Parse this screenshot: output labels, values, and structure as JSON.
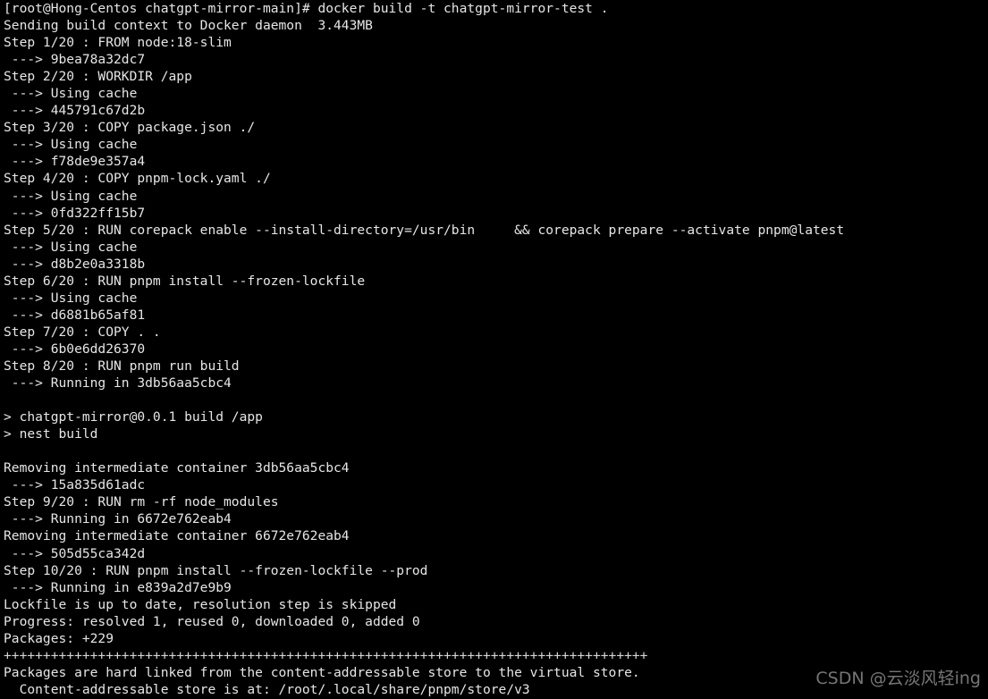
{
  "terminal": {
    "colors": {
      "background": "#000000",
      "foreground": "#e6e6e6",
      "watermark": "#8a8a8a"
    },
    "prompt": {
      "user": "root",
      "host": "Hong-Centos",
      "directory": "chatgpt-mirror-main",
      "symbol": "#",
      "full": "[root@Hong-Centos chatgpt-mirror-main]#"
    },
    "command": "docker build -t chatgpt-mirror-test .",
    "lines": [
      "[root@Hong-Centos chatgpt-mirror-main]# docker build -t chatgpt-mirror-test .",
      "Sending build context to Docker daemon  3.443MB",
      "Step 1/20 : FROM node:18-slim",
      " ---> 9bea78a32dc7",
      "Step 2/20 : WORKDIR /app",
      " ---> Using cache",
      " ---> 445791c67d2b",
      "Step 3/20 : COPY package.json ./",
      " ---> Using cache",
      " ---> f78de9e357a4",
      "Step 4/20 : COPY pnpm-lock.yaml ./",
      " ---> Using cache",
      " ---> 0fd322ff15b7",
      "Step 5/20 : RUN corepack enable --install-directory=/usr/bin     && corepack prepare --activate pnpm@latest",
      " ---> Using cache",
      " ---> d8b2e0a3318b",
      "Step 6/20 : RUN pnpm install --frozen-lockfile",
      " ---> Using cache",
      " ---> d6881b65af81",
      "Step 7/20 : COPY . .",
      " ---> 6b0e6dd26370",
      "Step 8/20 : RUN pnpm run build",
      " ---> Running in 3db56aa5cbc4",
      "",
      "> chatgpt-mirror@0.0.1 build /app",
      "> nest build",
      "",
      "Removing intermediate container 3db56aa5cbc4",
      " ---> 15a835d61adc",
      "Step 9/20 : RUN rm -rf node_modules",
      " ---> Running in 6672e762eab4",
      "Removing intermediate container 6672e762eab4",
      " ---> 505d55ca342d",
      "Step 10/20 : RUN pnpm install --frozen-lockfile --prod",
      " ---> Running in e839a2d7e9b9",
      "Lockfile is up to date, resolution step is skipped",
      "Progress: resolved 1, reused 0, downloaded 0, added 0",
      "Packages: +229",
      "++++++++++++++++++++++++++++++++++++++++++++++++++++++++++++++++++++++++++++++++++",
      "Packages are hard linked from the content-addressable store to the virtual store.",
      "  Content-addressable store is at: /root/.local/share/pnpm/store/v3"
    ],
    "build": {
      "context_size": "3.443MB",
      "total_steps": 20,
      "base_image": "node:18-slim",
      "package_name": "chatgpt-mirror@0.0.1",
      "build_script": "nest build",
      "image_tag": "chatgpt-mirror-test",
      "packages_added": "+229",
      "store_path": "/root/.local/share/pnpm/store/v3"
    }
  },
  "watermark": {
    "text": "CSDN @云淡风轻ing"
  }
}
